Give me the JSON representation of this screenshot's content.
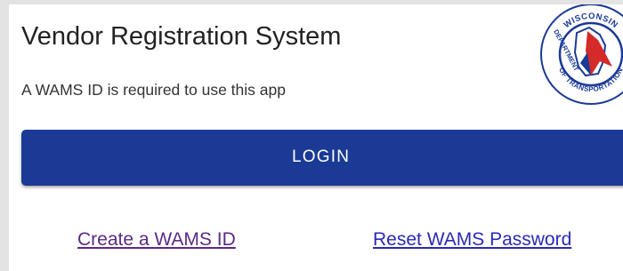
{
  "app": {
    "title": "Vendor Registration System",
    "subtitle": "A WAMS ID is required to use this app"
  },
  "logo": {
    "icon": "wisconsin-dot-seal-icon",
    "text_top": "WISCONSIN",
    "text_left": "DEPARTMENT",
    "text_bottom": "OF TRANSPORTATION",
    "colors": {
      "ring": "#1b3a96",
      "map": "#ffffff",
      "arrow": "#d42a2a"
    }
  },
  "login": {
    "label": "LOGIN",
    "color": "#1b3a96"
  },
  "links": {
    "create": "Create a WAMS ID",
    "reset": "Reset WAMS Password",
    "create_color": "#5b2a86",
    "reset_color": "#2a2ab8"
  }
}
